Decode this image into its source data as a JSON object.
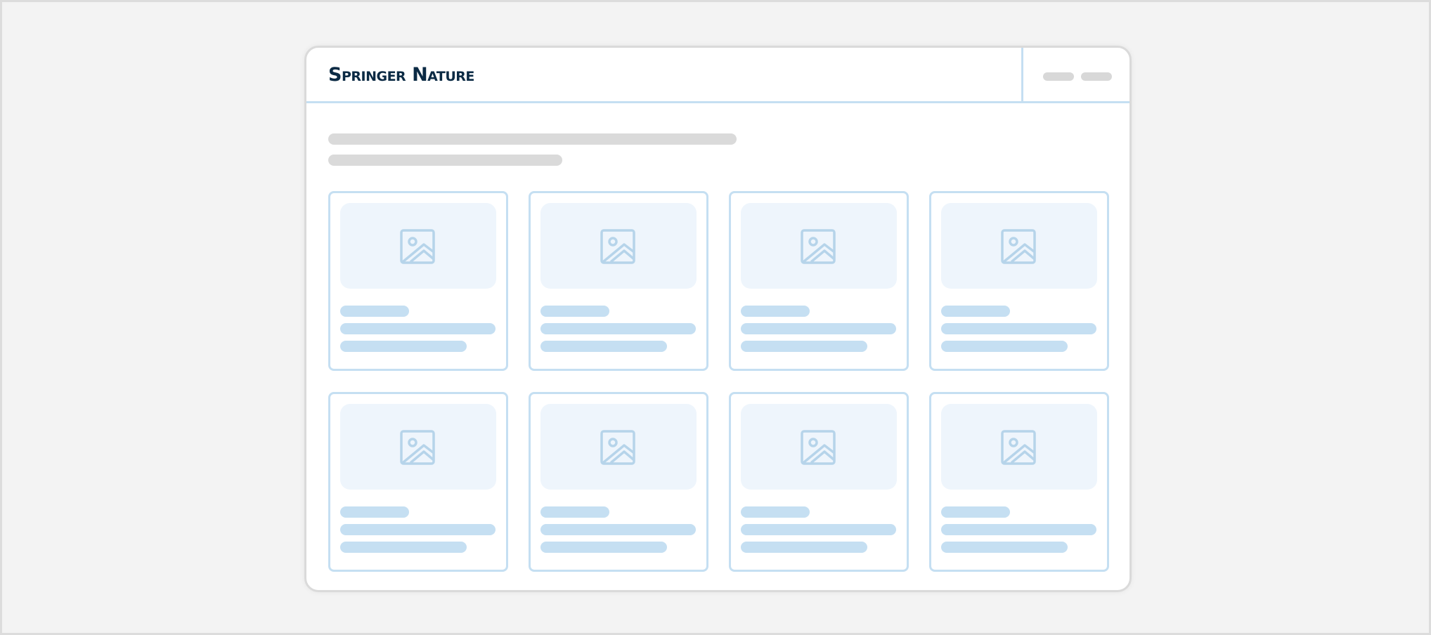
{
  "header": {
    "logo_text": "Springer Nature"
  },
  "colors": {
    "brand_text": "#0b2a44",
    "accent_light": "#c5dff2",
    "placeholder_gray": "#dadada",
    "thumb_bg": "#eef5fc",
    "page_bg": "#f3f3f3"
  },
  "icons": {
    "card_thumbnail": "image-placeholder-icon"
  }
}
